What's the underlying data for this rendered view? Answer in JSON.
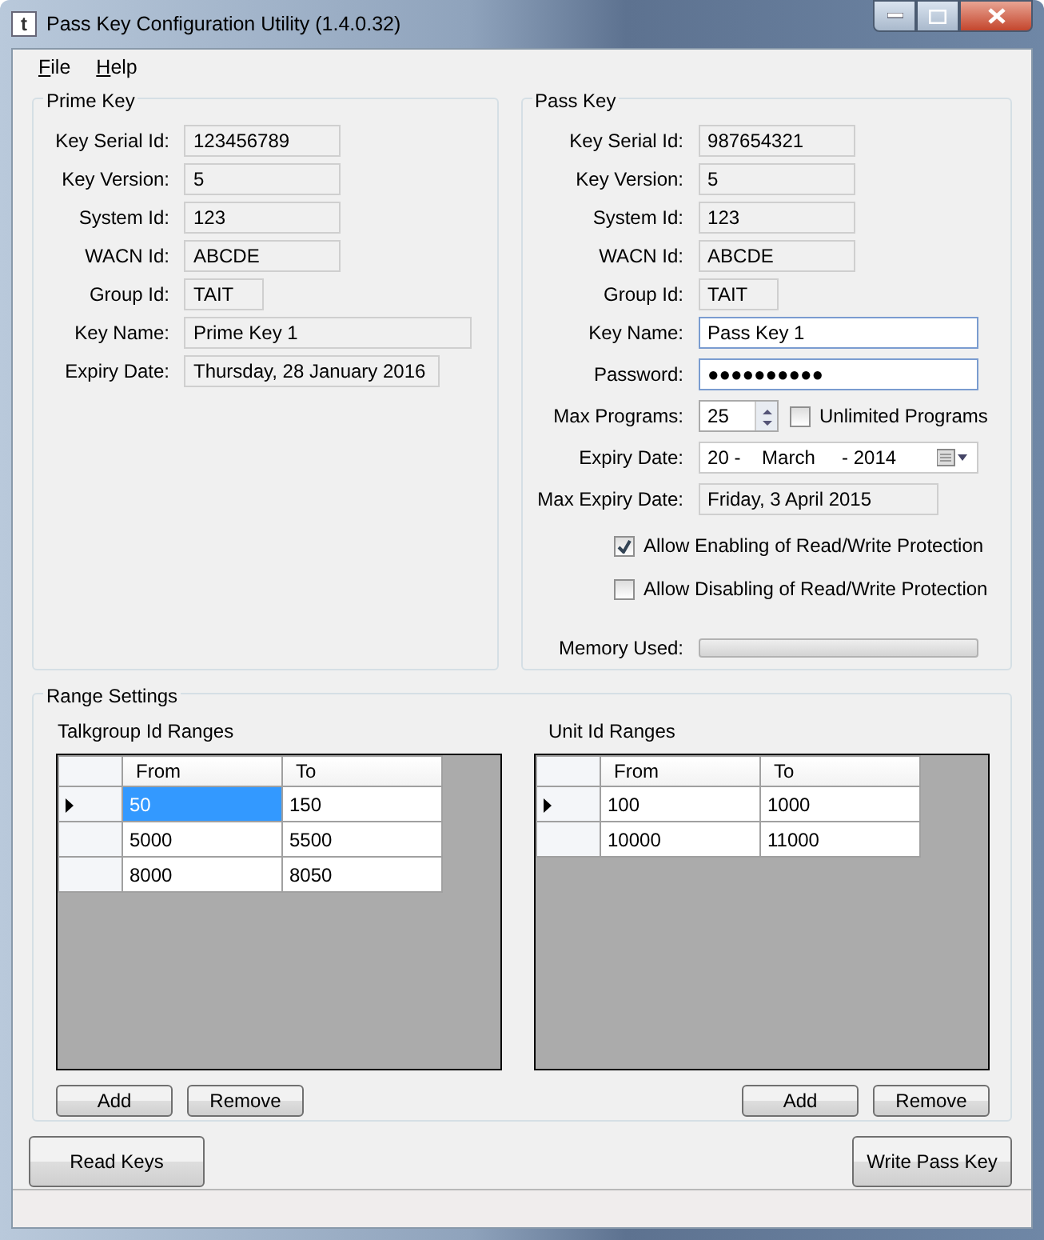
{
  "window": {
    "icon_text": "t",
    "title": "Pass Key Configuration Utility (1.4.0.32)"
  },
  "menu": [
    "File",
    "Help"
  ],
  "prime_key": {
    "title": "Prime Key",
    "fields": [
      {
        "label": "Key Serial Id:",
        "value": "123456789"
      },
      {
        "label": "Key Version:",
        "value": "5"
      },
      {
        "label": "System Id:",
        "value": "123"
      },
      {
        "label": "WACN Id:",
        "value": "ABCDE"
      },
      {
        "label": "Group Id:",
        "value": "TAIT"
      },
      {
        "label": "Key Name:",
        "value": "Prime Key 1"
      },
      {
        "label": "Expiry Date:",
        "value": "Thursday, 28 January 2016"
      }
    ]
  },
  "pass_key": {
    "title": "Pass Key",
    "fields": [
      {
        "label": "Key Serial Id:",
        "value": "987654321",
        "kind": "readonly"
      },
      {
        "label": "Key Version:",
        "value": "5",
        "kind": "readonly"
      },
      {
        "label": "System Id:",
        "value": "123",
        "kind": "readonly"
      },
      {
        "label": "WACN Id:",
        "value": "ABCDE",
        "kind": "readonly"
      },
      {
        "label": "Group Id:",
        "value": "TAIT",
        "kind": "readonly"
      },
      {
        "label": "Key Name:",
        "value": "Pass Key 1",
        "kind": "input"
      },
      {
        "label": "Password:",
        "value": "●●●●●●●●●●",
        "kind": "input"
      },
      {
        "label": "Max Programs:",
        "value": "25",
        "kind": "spin",
        "checkbox": {
          "label": "Unlimited Programs",
          "checked": false
        }
      },
      {
        "label": "Expiry Date:",
        "value": "20 -    March     - 2014",
        "kind": "date"
      },
      {
        "label": "Max Expiry Date:",
        "value": "Friday, 3 April 2015",
        "kind": "readonly"
      }
    ],
    "checkboxes": [
      {
        "label": "Allow Enabling of Read/Write Protection",
        "checked": true
      },
      {
        "label": "Allow Disabling of Read/Write Protection",
        "checked": false
      }
    ],
    "memory": {
      "label": "Memory Used:",
      "level": 0
    }
  },
  "range_settings": {
    "title": "Range Settings",
    "tables": [
      {
        "title": "Talkgroup Id Ranges",
        "columns": [
          "From",
          "To"
        ],
        "rows": [
          {
            "current": true,
            "cells": [
              {
                "text": "50",
                "selected": true
              },
              {
                "text": "150",
                "selected": false
              }
            ]
          },
          {
            "current": false,
            "cells": [
              {
                "text": "5000",
                "selected": false
              },
              {
                "text": "5500",
                "selected": false
              }
            ]
          },
          {
            "current": false,
            "cells": [
              {
                "text": "8000",
                "selected": false
              },
              {
                "text": "8050",
                "selected": false
              }
            ]
          }
        ],
        "buttons": [
          "Add",
          "Remove"
        ]
      },
      {
        "title": "Unit Id Ranges",
        "columns": [
          "From",
          "To"
        ],
        "rows": [
          {
            "current": true,
            "cells": [
              {
                "text": "100",
                "selected": false
              },
              {
                "text": "1000",
                "selected": false
              }
            ]
          },
          {
            "current": false,
            "cells": [
              {
                "text": "10000",
                "selected": false
              },
              {
                "text": "11000",
                "selected": false
              }
            ]
          }
        ],
        "buttons": [
          "Add",
          "Remove"
        ]
      }
    ]
  },
  "buttons": [
    "Read Keys",
    "Write Pass Key"
  ]
}
